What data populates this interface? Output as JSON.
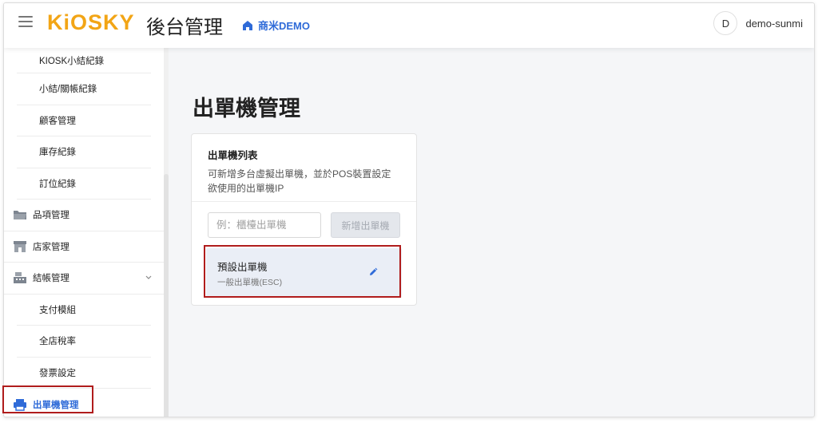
{
  "header": {
    "logo": "KiOSKY",
    "title": "後台管理",
    "store_name": "商米DEMO",
    "user_initial": "D",
    "username": "demo-sunmi"
  },
  "sidebar": {
    "items": [
      {
        "label": "KIOSK小結紀錄",
        "type": "sub"
      },
      {
        "label": "小結/關帳紀錄",
        "type": "sub"
      },
      {
        "label": "顧客管理",
        "type": "sub"
      },
      {
        "label": "庫存紀錄",
        "type": "sub"
      },
      {
        "label": "訂位紀錄",
        "type": "sub"
      },
      {
        "label": "品項管理",
        "type": "group",
        "icon": "folder-icon"
      },
      {
        "label": "店家管理",
        "type": "group",
        "icon": "store-icon"
      },
      {
        "label": "結帳管理",
        "type": "group",
        "icon": "cash-register-icon"
      },
      {
        "label": "支付模組",
        "type": "sub"
      },
      {
        "label": "全店稅率",
        "type": "sub"
      },
      {
        "label": "發票設定",
        "type": "sub"
      },
      {
        "label": "出單機管理",
        "type": "active",
        "icon": "printer-icon"
      }
    ]
  },
  "main": {
    "page_title": "出單機管理",
    "card": {
      "title": "出單機列表",
      "desc_line1": "可新增多台虛擬出單機，並於POS裝置設定",
      "desc_line2": "欲使用的出單機IP",
      "input_placeholder": "例：櫃檯出單機",
      "add_button": "新增出單機",
      "printer": {
        "name": "預設出單機",
        "type": "一般出單機(ESC)"
      }
    }
  },
  "colors": {
    "accent": "#2f6bd8",
    "logo": "#f2a516",
    "highlight": "#b01c1c"
  }
}
